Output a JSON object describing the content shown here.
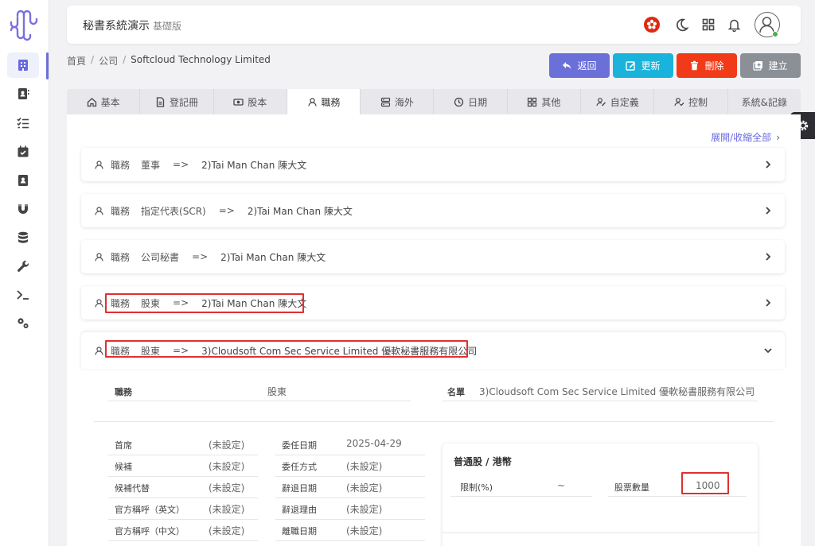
{
  "app": {
    "title": "秘書系統演示",
    "edition": "基礎版"
  },
  "breadcrumb": {
    "home": "首頁",
    "company": "公司",
    "current": "Softcloud Technology Limited",
    "separator": "/"
  },
  "buttons": {
    "back": "返回",
    "update": "更新",
    "delete": "刪除",
    "create": "建立"
  },
  "colors": {
    "back": "#6b6fd8",
    "update": "#1ab3dc",
    "delete": "#f13b18",
    "create": "#8a9096",
    "accent": "#6a6ae0",
    "highlight": "#e03030"
  },
  "tabs": [
    {
      "label": "基本",
      "icon": "home-icon"
    },
    {
      "label": "登記冊",
      "icon": "document-icon"
    },
    {
      "label": "股本",
      "icon": "money-icon"
    },
    {
      "label": "職務",
      "icon": "user-icon"
    },
    {
      "label": "海外",
      "icon": "server-icon"
    },
    {
      "label": "日期",
      "icon": "clock-icon"
    },
    {
      "label": "其他",
      "icon": "grid-icon"
    },
    {
      "label": "自定義",
      "icon": "user-edit-icon"
    },
    {
      "label": "控制",
      "icon": "user-check-icon"
    },
    {
      "label": "系統&記錄",
      "icon": ""
    }
  ],
  "panel": {
    "expand_all": "展開/收縮全部",
    "arrow": "=>",
    "chevron": "›"
  },
  "roles": [
    {
      "k": "職務",
      "role": "董事",
      "person": "2)Tai Man Chan 陳大文"
    },
    {
      "k": "職務",
      "role": "指定代表(SCR)",
      "person": "2)Tai Man Chan 陳大文"
    },
    {
      "k": "職務",
      "role": "公司秘書",
      "person": "2)Tai Man Chan 陳大文"
    },
    {
      "k": "職務",
      "role": "股東",
      "person": "2)Tai Man Chan 陳大文"
    },
    {
      "k": "職務",
      "role": "股東",
      "person": "3)Cloudsoft Com Sec Service Limited 優軟秘書服務有限公司"
    }
  ],
  "detail": {
    "role_label": "職務",
    "role_value": "股東",
    "name_label": "名單",
    "name_value": "3)Cloudsoft Com Sec Service Limited 優軟秘書服務有限公司",
    "left_fields": [
      {
        "label": "首席",
        "value": "(未設定)"
      },
      {
        "label": "候補",
        "value": "(未設定)"
      },
      {
        "label": "候補代替",
        "value": "(未設定)"
      },
      {
        "label": "官方稱呼（英文）",
        "value": "(未設定)"
      },
      {
        "label": "官方稱呼（中文）",
        "value": "(未設定)"
      }
    ],
    "mid_fields": [
      {
        "label": "委任日期",
        "value": "2025-04-29"
      },
      {
        "label": "委任方式",
        "value": "(未設定)"
      },
      {
        "label": "辭退日期",
        "value": "(未設定)"
      },
      {
        "label": "辭退理由",
        "value": "(未設定)"
      },
      {
        "label": "離職日期",
        "value": "(未設定)"
      }
    ],
    "share": {
      "title": "普通股 / 港幣",
      "limit_label": "限制(%)",
      "limit_value": "~",
      "qty_label": "股票數量",
      "qty_value": "1000"
    }
  }
}
